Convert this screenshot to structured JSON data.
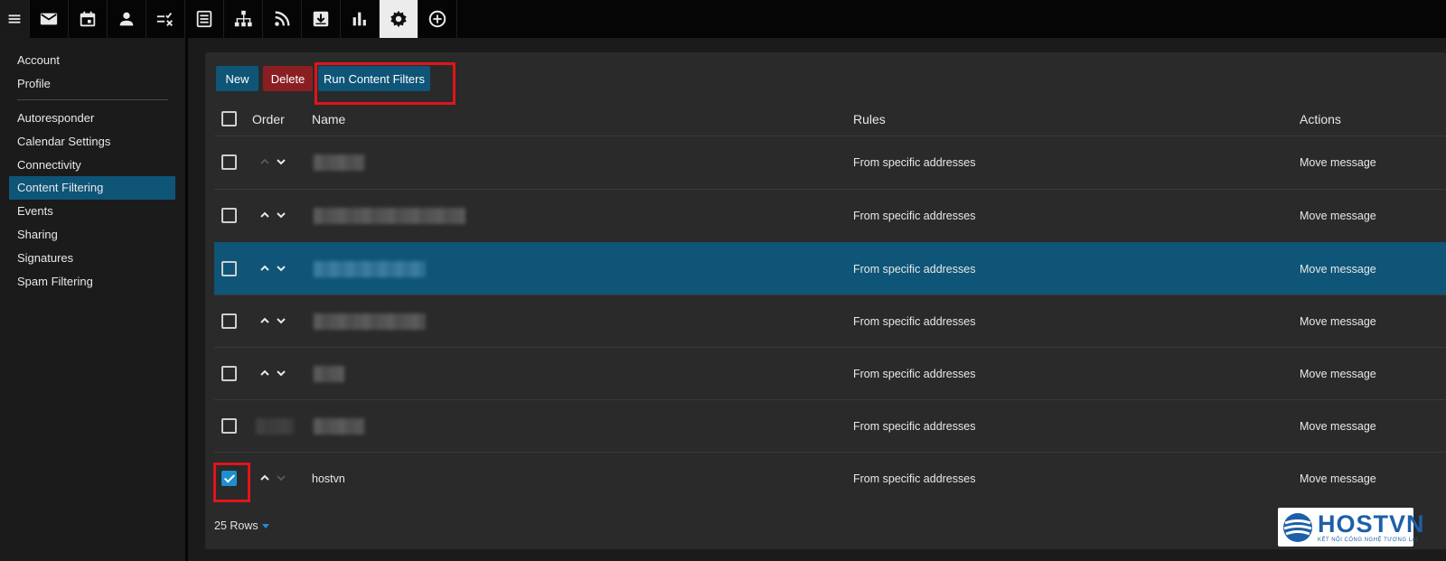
{
  "topbar": {
    "icons": [
      "menu-icon",
      "mail-icon",
      "calendar-icon",
      "contacts-icon",
      "tasks-icon",
      "notes-icon",
      "sitemap-icon",
      "rss-icon",
      "download-icon",
      "reports-icon",
      "settings-icon",
      "add-circle-icon"
    ],
    "active": "settings-icon"
  },
  "sidebar": {
    "group1": [
      "Account",
      "Profile"
    ],
    "group2": [
      "Autoresponder",
      "Calendar Settings",
      "Connectivity",
      "Content Filtering",
      "Events",
      "Sharing",
      "Signatures",
      "Spam Filtering"
    ],
    "active": "Content Filtering"
  },
  "toolbar": {
    "new_label": "New",
    "delete_label": "Delete",
    "run_label": "Run Content Filters"
  },
  "table": {
    "headers": {
      "order": "Order",
      "name": "Name",
      "rules": "Rules",
      "actions": "Actions"
    },
    "rows": [
      {
        "name": "",
        "rules": "From specific addresses",
        "actions": "Move message",
        "checked": false,
        "highlighted": false
      },
      {
        "name": "",
        "rules": "From specific addresses",
        "actions": "Move message",
        "checked": false,
        "highlighted": false
      },
      {
        "name": "",
        "rules": "From specific addresses",
        "actions": "Move message",
        "checked": false,
        "highlighted": true
      },
      {
        "name": "",
        "rules": "From specific addresses",
        "actions": "Move message",
        "checked": false,
        "highlighted": false
      },
      {
        "name": "",
        "rules": "From specific addresses",
        "actions": "Move message",
        "checked": false,
        "highlighted": false
      },
      {
        "name": "",
        "rules": "From specific addresses",
        "actions": "Move message",
        "checked": false,
        "highlighted": false
      },
      {
        "name": "hostvn",
        "rules": "From specific addresses",
        "actions": "Move message",
        "checked": true,
        "highlighted": false
      }
    ]
  },
  "pagination": {
    "rows_label": "25 Rows"
  },
  "watermark": {
    "brand": "HOSTVN",
    "tagline": "KẾT NỐI CÔNG NGHỆ TƯƠNG LAI"
  },
  "colors": {
    "accent": "#0e5578",
    "danger": "#8a1f22",
    "highlight_box": "#e0141b",
    "checkbox_checked": "#1e8fcf"
  }
}
